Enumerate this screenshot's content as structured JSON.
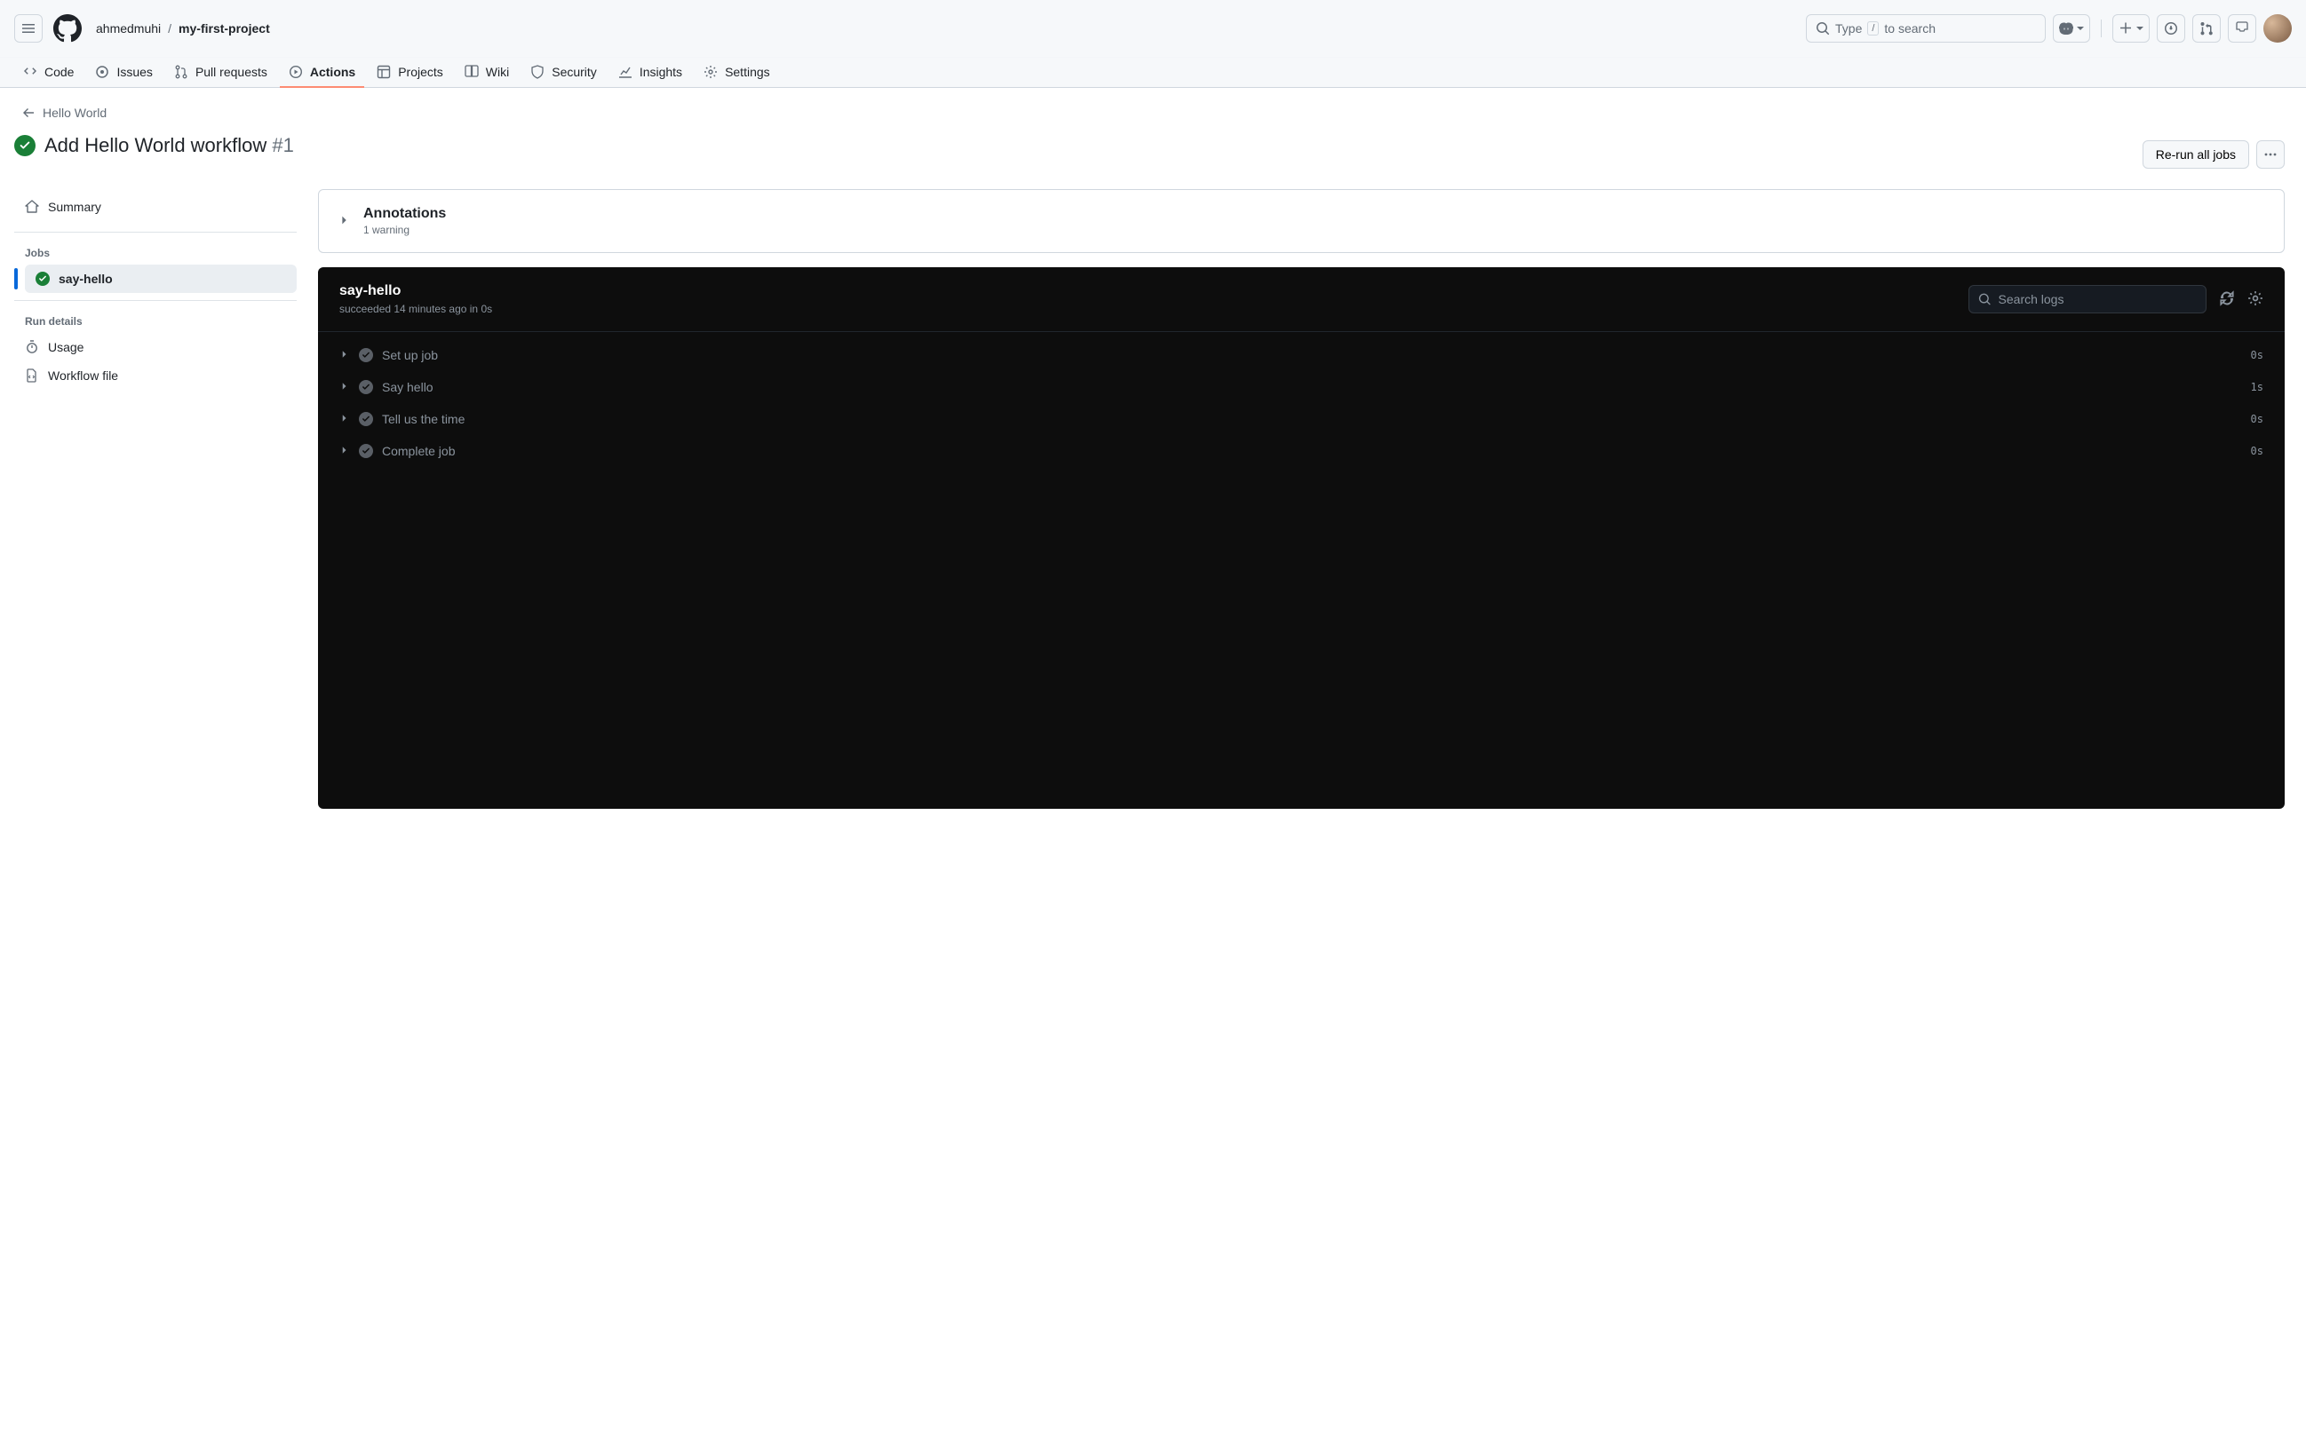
{
  "header": {
    "owner": "ahmedmuhi",
    "repo": "my-first-project",
    "search_hint_pre": "Type",
    "search_key": "/",
    "search_hint_post": "to search"
  },
  "nav": {
    "code": "Code",
    "issues": "Issues",
    "pulls": "Pull requests",
    "actions": "Actions",
    "projects": "Projects",
    "wiki": "Wiki",
    "security": "Security",
    "insights": "Insights",
    "settings": "Settings"
  },
  "run": {
    "back": "Hello World",
    "title": "Add Hello World workflow",
    "number": "#1",
    "rerun": "Re-run all jobs"
  },
  "sidebar": {
    "summary": "Summary",
    "jobs_heading": "Jobs",
    "job_name": "say-hello",
    "run_details_heading": "Run details",
    "usage": "Usage",
    "workflow_file": "Workflow file"
  },
  "annotations": {
    "title": "Annotations",
    "subtitle": "1 warning"
  },
  "log": {
    "title": "say-hello",
    "subtitle": "succeeded 14 minutes ago in 0s",
    "search_placeholder": "Search logs",
    "steps": [
      {
        "name": "Set up job",
        "duration": "0s"
      },
      {
        "name": "Say hello",
        "duration": "1s"
      },
      {
        "name": "Tell us the time",
        "duration": "0s"
      },
      {
        "name": "Complete job",
        "duration": "0s"
      }
    ]
  }
}
